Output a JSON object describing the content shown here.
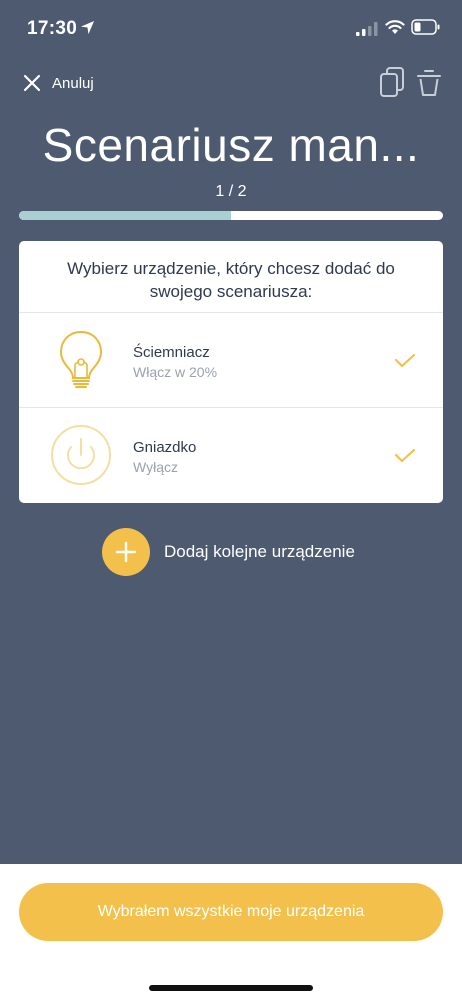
{
  "status_bar": {
    "time": "17:30"
  },
  "header": {
    "cancel_label": "Anuluj",
    "title": "Scenariusz man...",
    "step": "1 / 2",
    "progress": 0.5
  },
  "card": {
    "instruction": "Wybierz urządzenie, który chcesz dodać do swojego scenariusza:",
    "devices": [
      {
        "name": "Ściemniacz",
        "action": "Włącz w 20%",
        "icon": "lightbulb-icon",
        "selected": true
      },
      {
        "name": "Gniazdko",
        "action": "Wyłącz",
        "icon": "power-outlet-icon",
        "selected": true
      }
    ]
  },
  "add_device": {
    "label": "Dodaj kolejne urządzenie"
  },
  "footer": {
    "confirm_label": "Wybrałem wszystkie moje urządzenia"
  },
  "colors": {
    "background": "#4d5a70",
    "accent": "#f3c14b",
    "progress_fill": "#a9cfd3",
    "card_text": "#2f3a4d",
    "muted_text": "#9aa2ad"
  }
}
